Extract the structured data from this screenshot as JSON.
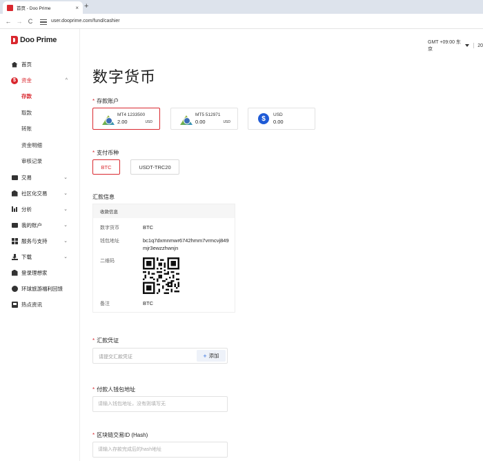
{
  "browser": {
    "tab_title": "首页 - Doo Prime",
    "tab_close": "×",
    "new_tab": "+",
    "back": "←",
    "forward": "→",
    "reload": "C",
    "url": "user.dooprime.com/fund/cashier"
  },
  "brand": {
    "name": "Doo Prime",
    "accent": "#d9272e"
  },
  "header": {
    "timezone": "GMT +09:00 东京",
    "year_partial": "20"
  },
  "sidebar": {
    "home": "首页",
    "funds": "资金",
    "funds_sub": [
      "存款",
      "取款",
      "转账",
      "资金明细",
      "审核记录"
    ],
    "trade": "交易",
    "social_trade": "社区化交易",
    "analysis": "分析",
    "my_account": "我的账户",
    "services": "服务与支持",
    "download": "下载",
    "login_ideal": "登录理想家",
    "travel": "环球旅游福利回馈",
    "news": "热点资讯"
  },
  "page": {
    "title": "数字货币",
    "deposit_account_label": "存款账户",
    "accounts": [
      {
        "name": "MT4 1233500",
        "balance": "2.00",
        "currency": "USD",
        "icon": "mt4-icon"
      },
      {
        "name": "MT5 512971",
        "balance": "0.00",
        "currency": "USD",
        "icon": "mt5-icon"
      },
      {
        "name": "USD",
        "balance": "0.00",
        "currency": "",
        "icon": "dollar-icon"
      }
    ],
    "currency_label": "支付币种",
    "currencies": [
      "BTC",
      "USDT-TRC20"
    ],
    "remit_info_label": "汇款信息",
    "receipt_info": {
      "header": "收款信息",
      "crypto_label": "数字货币",
      "crypto_value": "BTC",
      "wallet_label": "钱包地址",
      "wallet_value": "bc1q7dxmnmwr6742hmm7vrmcvj849mjr3ewzzhwnjn",
      "qr_label": "二维码",
      "note_label": "备注",
      "note_value": "BTC"
    },
    "voucher_label": "汇款凭证",
    "voucher_placeholder": "请提交汇款凭证",
    "add_button": "添加",
    "payer_wallet_label": "付款人钱包地址",
    "payer_wallet_placeholder": "请输入钱包地址，没有则填写无",
    "hash_label": "区块链交易ID (Hash)",
    "hash_placeholder": "请输入存款完成后的hash地址"
  }
}
